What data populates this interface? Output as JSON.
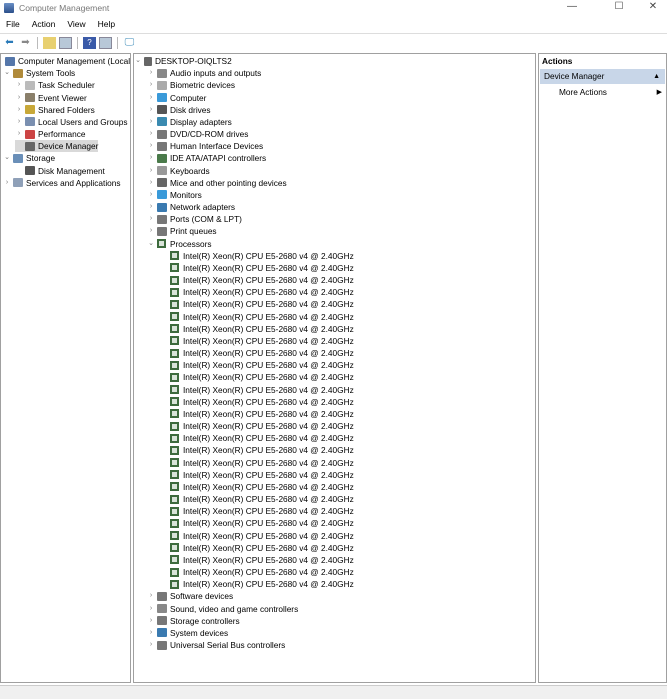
{
  "window": {
    "title": "Computer Management",
    "min": "—",
    "max": "☐",
    "close": "✕"
  },
  "menu": [
    "File",
    "Action",
    "View",
    "Help"
  ],
  "toolbar": [
    "back-icon",
    "forward-icon",
    "up-folder-icon",
    "show-hide-tree-icon",
    "help-icon",
    "properties-icon",
    "computer-icon"
  ],
  "left_tree": [
    {
      "label": "Computer Management (Local",
      "level": 0,
      "chev": "",
      "icon": "computer-management-icon",
      "color": "#5577aa"
    },
    {
      "label": "System Tools",
      "level": 1,
      "chev": "v",
      "icon": "tools-icon",
      "color": "#b08a3a"
    },
    {
      "label": "Task Scheduler",
      "level": 2,
      "chev": ">",
      "icon": "clock-icon",
      "color": "#bbbbbb"
    },
    {
      "label": "Event Viewer",
      "level": 2,
      "chev": ">",
      "icon": "event-viewer-icon",
      "color": "#8a7f6a"
    },
    {
      "label": "Shared Folders",
      "level": 2,
      "chev": ">",
      "icon": "shared-folder-icon",
      "color": "#c8a838"
    },
    {
      "label": "Local Users and Groups",
      "level": 2,
      "chev": ">",
      "icon": "users-icon",
      "color": "#7a8fb0"
    },
    {
      "label": "Performance",
      "level": 2,
      "chev": ">",
      "icon": "performance-icon",
      "color": "#cc4444"
    },
    {
      "label": "Device Manager",
      "level": 2,
      "chev": "",
      "icon": "device-manager-icon",
      "color": "#666666",
      "selected": true
    },
    {
      "label": "Storage",
      "level": 1,
      "chev": "v",
      "icon": "storage-icon",
      "color": "#6a8fb8"
    },
    {
      "label": "Disk Management",
      "level": 2,
      "chev": "",
      "icon": "disk-icon",
      "color": "#555555"
    },
    {
      "label": "Services and Applications",
      "level": 1,
      "chev": ">",
      "icon": "services-icon",
      "color": "#8fa0b8"
    }
  ],
  "device_tree": {
    "root": "DESKTOP-OIQLTS2",
    "categories_before": [
      {
        "label": "Audio inputs and outputs",
        "icon": "speaker-icon",
        "color": "#888888"
      },
      {
        "label": "Biometric devices",
        "icon": "biometric-icon",
        "color": "#aaaaaa"
      },
      {
        "label": "Computer",
        "icon": "monitor-icon",
        "color": "#3a9ad9"
      },
      {
        "label": "Disk drives",
        "icon": "disk-drive-icon",
        "color": "#555555"
      },
      {
        "label": "Display adapters",
        "icon": "display-adapter-icon",
        "color": "#3a8ab0"
      },
      {
        "label": "DVD/CD-ROM drives",
        "icon": "dvd-icon",
        "color": "#777777"
      },
      {
        "label": "Human Interface Devices",
        "icon": "hid-icon",
        "color": "#777777"
      },
      {
        "label": "IDE ATA/ATAPI controllers",
        "icon": "ide-icon",
        "color": "#4a7a4a"
      },
      {
        "label": "Keyboards",
        "icon": "keyboard-icon",
        "color": "#999999"
      },
      {
        "label": "Mice and other pointing devices",
        "icon": "mouse-icon",
        "color": "#666666"
      },
      {
        "label": "Monitors",
        "icon": "monitor-icon",
        "color": "#3a9ad9"
      },
      {
        "label": "Network adapters",
        "icon": "network-icon",
        "color": "#3a7ab0"
      },
      {
        "label": "Ports (COM & LPT)",
        "icon": "port-icon",
        "color": "#777777"
      },
      {
        "label": "Print queues",
        "icon": "printer-icon",
        "color": "#777777"
      }
    ],
    "processors_label": "Processors",
    "processors": [
      "Intel(R) Xeon(R) CPU E5-2680 v4 @ 2.40GHz",
      "Intel(R) Xeon(R) CPU E5-2680 v4 @ 2.40GHz",
      "Intel(R) Xeon(R) CPU E5-2680 v4 @ 2.40GHz",
      "Intel(R) Xeon(R) CPU E5-2680 v4 @ 2.40GHz",
      "Intel(R) Xeon(R) CPU E5-2680 v4 @ 2.40GHz",
      "Intel(R) Xeon(R) CPU E5-2680 v4 @ 2.40GHz",
      "Intel(R) Xeon(R) CPU E5-2680 v4 @ 2.40GHz",
      "Intel(R) Xeon(R) CPU E5-2680 v4 @ 2.40GHz",
      "Intel(R) Xeon(R) CPU E5-2680 v4 @ 2.40GHz",
      "Intel(R) Xeon(R) CPU E5-2680 v4 @ 2.40GHz",
      "Intel(R) Xeon(R) CPU E5-2680 v4 @ 2.40GHz",
      "Intel(R) Xeon(R) CPU E5-2680 v4 @ 2.40GHz",
      "Intel(R) Xeon(R) CPU E5-2680 v4 @ 2.40GHz",
      "Intel(R) Xeon(R) CPU E5-2680 v4 @ 2.40GHz",
      "Intel(R) Xeon(R) CPU E5-2680 v4 @ 2.40GHz",
      "Intel(R) Xeon(R) CPU E5-2680 v4 @ 2.40GHz",
      "Intel(R) Xeon(R) CPU E5-2680 v4 @ 2.40GHz",
      "Intel(R) Xeon(R) CPU E5-2680 v4 @ 2.40GHz",
      "Intel(R) Xeon(R) CPU E5-2680 v4 @ 2.40GHz",
      "Intel(R) Xeon(R) CPU E5-2680 v4 @ 2.40GHz",
      "Intel(R) Xeon(R) CPU E5-2680 v4 @ 2.40GHz",
      "Intel(R) Xeon(R) CPU E5-2680 v4 @ 2.40GHz",
      "Intel(R) Xeon(R) CPU E5-2680 v4 @ 2.40GHz",
      "Intel(R) Xeon(R) CPU E5-2680 v4 @ 2.40GHz",
      "Intel(R) Xeon(R) CPU E5-2680 v4 @ 2.40GHz",
      "Intel(R) Xeon(R) CPU E5-2680 v4 @ 2.40GHz",
      "Intel(R) Xeon(R) CPU E5-2680 v4 @ 2.40GHz",
      "Intel(R) Xeon(R) CPU E5-2680 v4 @ 2.40GHz"
    ],
    "categories_after": [
      {
        "label": "Software devices",
        "icon": "software-device-icon",
        "color": "#777777"
      },
      {
        "label": "Sound, video and game controllers",
        "icon": "sound-icon",
        "color": "#888888"
      },
      {
        "label": "Storage controllers",
        "icon": "storage-controller-icon",
        "color": "#777777"
      },
      {
        "label": "System devices",
        "icon": "system-device-icon",
        "color": "#3a7ab0"
      },
      {
        "label": "Universal Serial Bus controllers",
        "icon": "usb-icon",
        "color": "#777777"
      }
    ]
  },
  "actions": {
    "header": "Actions",
    "section": "Device Manager",
    "more": "More Actions"
  }
}
